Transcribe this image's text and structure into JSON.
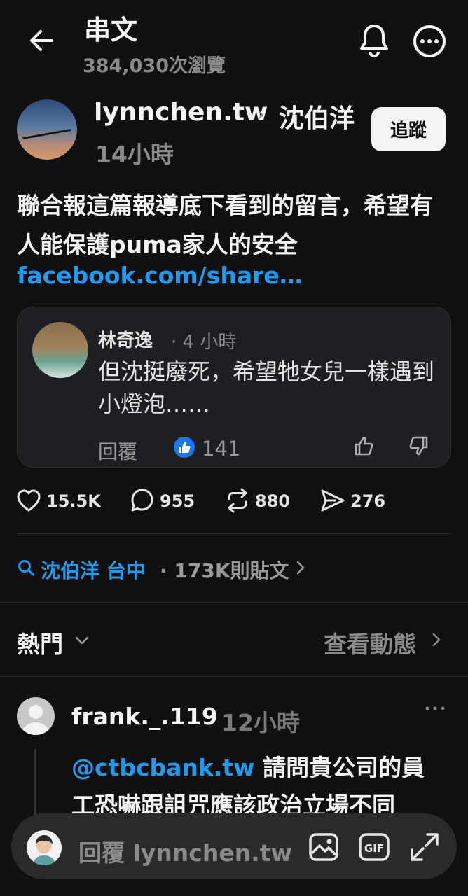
{
  "header": {
    "title": "串文",
    "views": "384,030次瀏覽"
  },
  "post": {
    "author": "lynnchen.tw",
    "separator": "›",
    "topic": "沈伯洋",
    "time": "14小時",
    "follow_label": "追蹤",
    "text": "聯合報這篇報導底下看到的留言，希望有人能保護puma家人的安全",
    "link": "facebook.com/share…",
    "embed": {
      "name": "林奇逸",
      "time": "· 4 小時",
      "text": "但沈挺廢死，希望牠女兒一樣遇到小燈泡……",
      "reply_label": "回覆",
      "likes": "141"
    },
    "stats": {
      "likes": "15.5K",
      "comments": "955",
      "reposts": "880",
      "shares": "276"
    }
  },
  "topic_row": {
    "tag": "沈伯洋 台中",
    "count": "· 173K則貼文"
  },
  "sort": {
    "label": "熱門",
    "activity": "查看動態"
  },
  "reply": {
    "user": "frank._.119",
    "time": "12小時",
    "mention": "@ctbcbank.tw",
    "text": " 請問貴公司的員工恐嚇跟詛咒應該政治立場不同"
  },
  "reply_bar": {
    "placeholder": "回覆 lynnchen.tw"
  },
  "colors": {
    "background": "#101010",
    "link": "#1d9bf0",
    "muted": "#8a8a8a",
    "like_badge": "#1877f2"
  }
}
